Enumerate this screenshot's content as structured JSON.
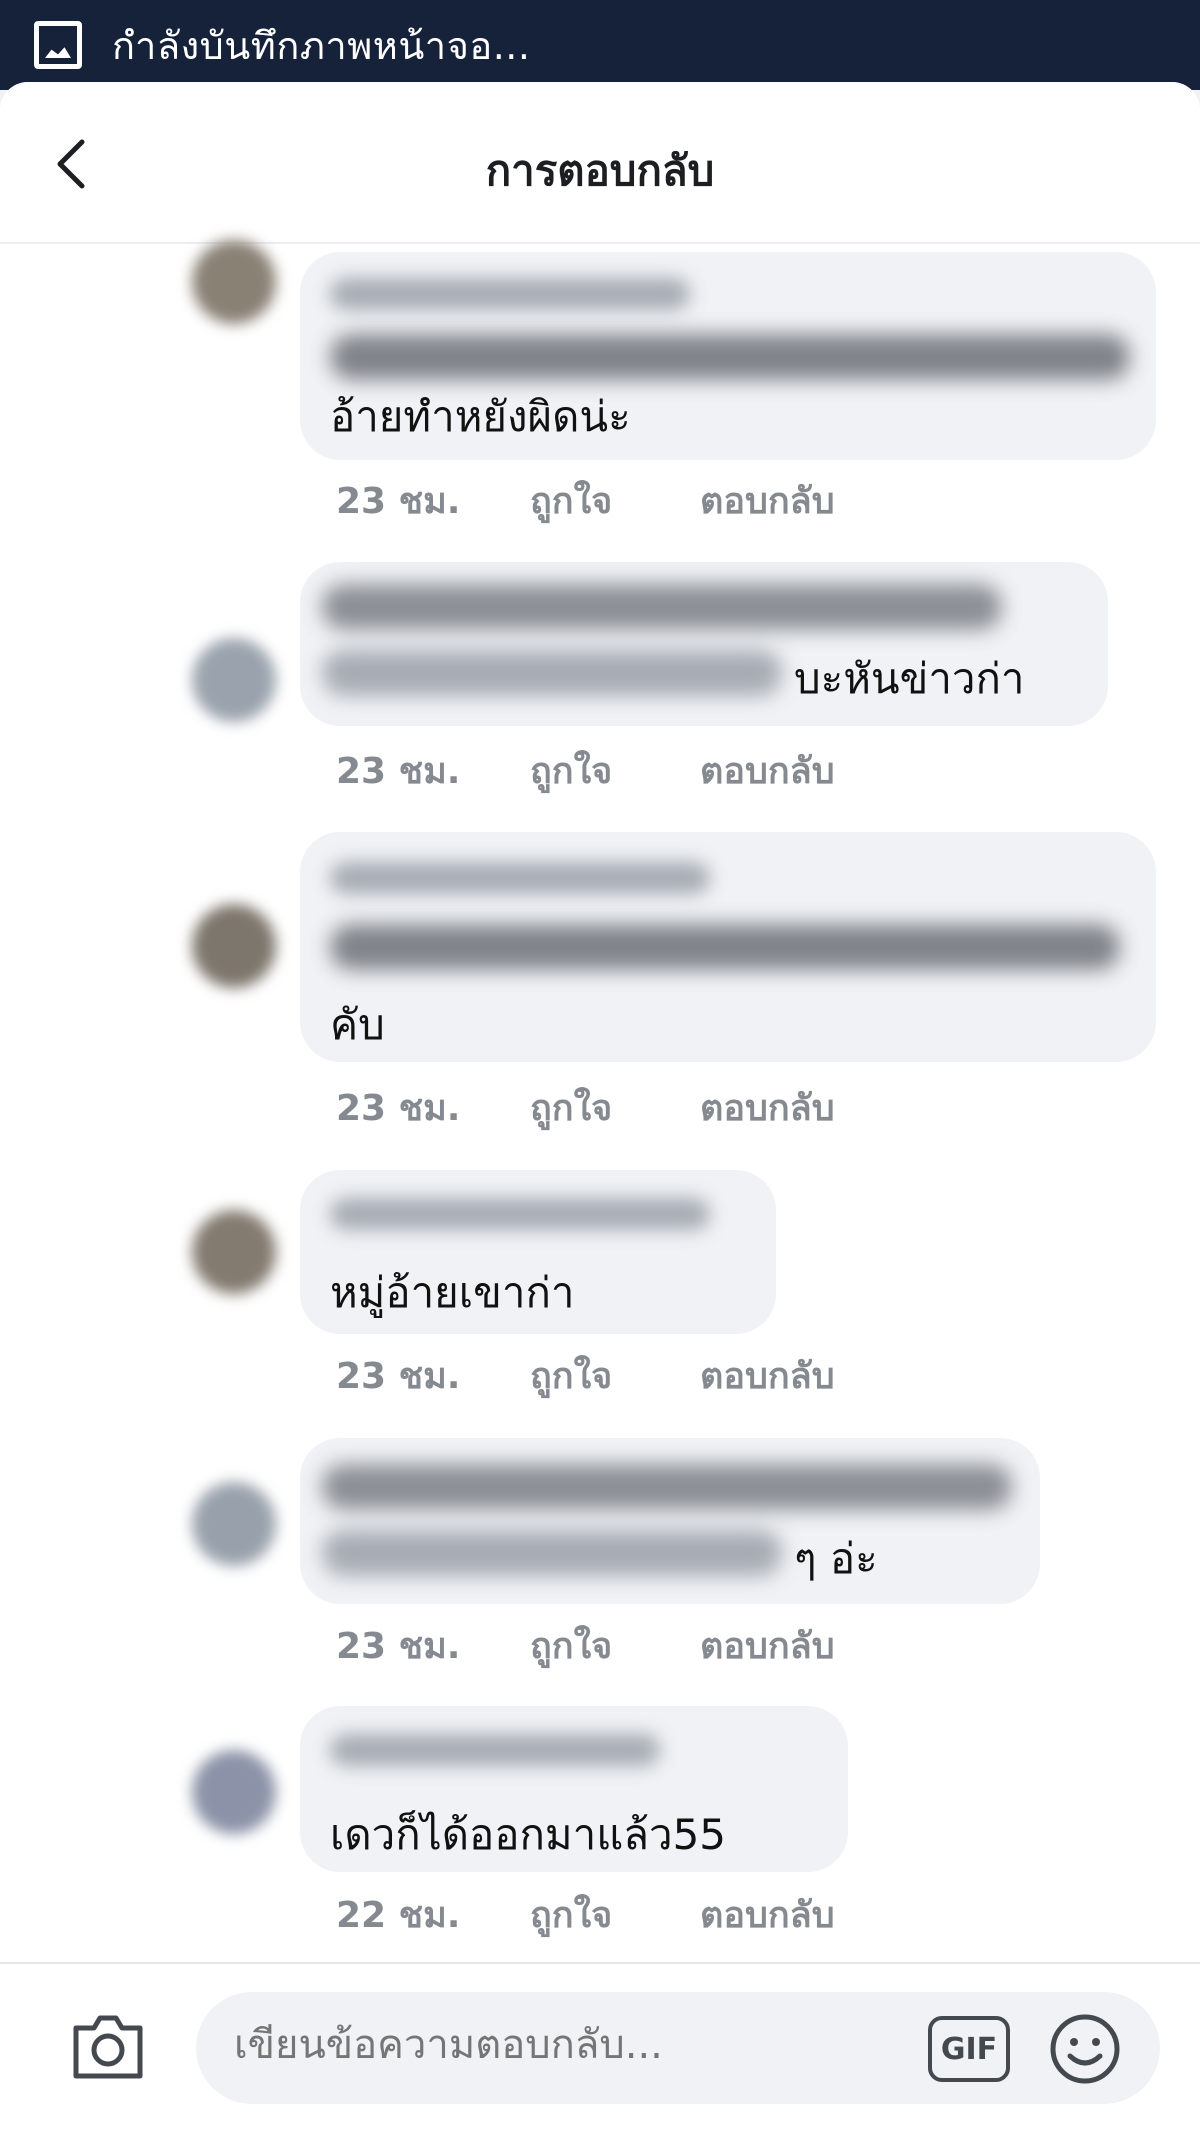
{
  "status_bar": {
    "text": "กำลังบันทึกภาพหน้าจอ..."
  },
  "header": {
    "title": "การตอบกลับ"
  },
  "replies": [
    {
      "visible_text": "อ้ายทำหยังผิดน่ะ",
      "time": "23 ชม.",
      "like": "ถูกใจ",
      "reply": "ตอบกลับ"
    },
    {
      "visible_text": "บะหันข่าวก่า",
      "time": "23 ชม.",
      "like": "ถูกใจ",
      "reply": "ตอบกลับ"
    },
    {
      "visible_text": "คับ",
      "time": "23 ชม.",
      "like": "ถูกใจ",
      "reply": "ตอบกลับ"
    },
    {
      "visible_text": "หมู่อ้ายเขาก่า",
      "time": "23 ชม.",
      "like": "ถูกใจ",
      "reply": "ตอบกลับ"
    },
    {
      "visible_text": "ๆ อ่ะ",
      "time": "23 ชม.",
      "like": "ถูกใจ",
      "reply": "ตอบกลับ"
    },
    {
      "visible_text": "เดวก็ได้ออกมาแล้ว55",
      "time": "22 ชม.",
      "like": "ถูกใจ",
      "reply": "ตอบกลับ"
    }
  ],
  "composer": {
    "placeholder": "เขียนข้อความตอบกลับ...",
    "gif_label": "GIF",
    "camera_icon": "camera-icon",
    "emoji_icon": "smiley-icon"
  },
  "colors": {
    "status_bar_bg": "#16213a",
    "bubble_bg": "#f0f2f5",
    "meta_text": "#858a91"
  }
}
